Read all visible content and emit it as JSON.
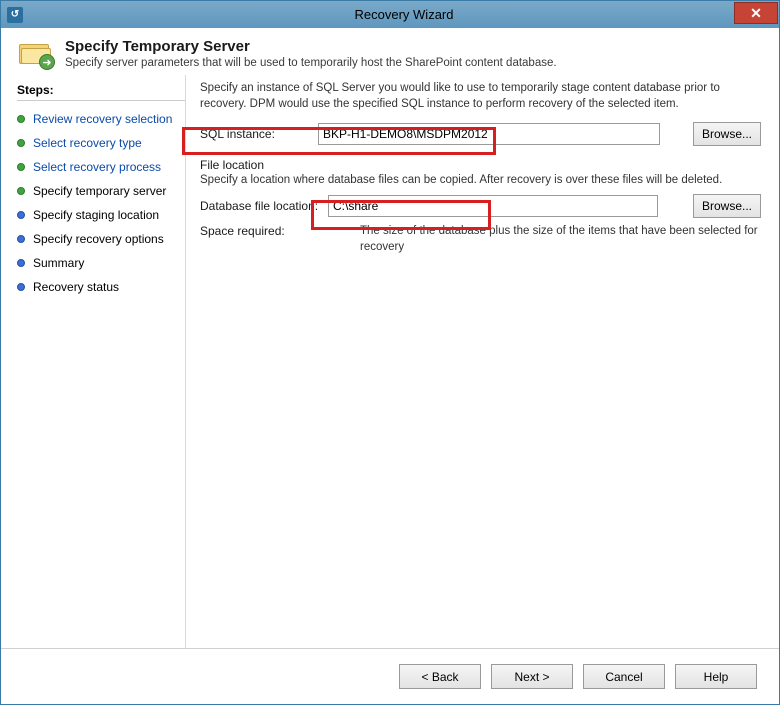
{
  "window": {
    "title": "Recovery Wizard",
    "close_glyph": "✕"
  },
  "header": {
    "title": "Specify Temporary Server",
    "subtitle": "Specify server parameters that will be used to temporarily host the SharePoint content database."
  },
  "sidebar": {
    "header": "Steps:",
    "items": [
      {
        "label": "Review recovery selection",
        "state": "done-link"
      },
      {
        "label": "Select recovery type",
        "state": "done-link"
      },
      {
        "label": "Select recovery process",
        "state": "done-link"
      },
      {
        "label": "Specify temporary server",
        "state": "current"
      },
      {
        "label": "Specify staging location",
        "state": "upcoming"
      },
      {
        "label": "Specify recovery options",
        "state": "upcoming"
      },
      {
        "label": "Summary",
        "state": "upcoming"
      },
      {
        "label": "Recovery status",
        "state": "upcoming"
      }
    ]
  },
  "content": {
    "intro": "Specify an instance of SQL Server you would like to use to temporarily stage content database prior to recovery. DPM would use the specified SQL instance to perform recovery of the selected item.",
    "sql_label": "SQL instance:",
    "sql_value": "BKP-H1-DEMO8\\MSDPM2012",
    "browse_label": "Browse...",
    "file_section_label": "File location",
    "file_note": "Specify a location where database files can be copied. After recovery is over these files will be deleted.",
    "dbloc_label": "Database file location:",
    "dbloc_value": "C:\\share",
    "space_label": "Space required:",
    "space_value": "The size of the database plus the size of the items that have been selected for recovery"
  },
  "footer": {
    "back": "< Back",
    "next": "Next >",
    "cancel": "Cancel",
    "help": "Help"
  }
}
